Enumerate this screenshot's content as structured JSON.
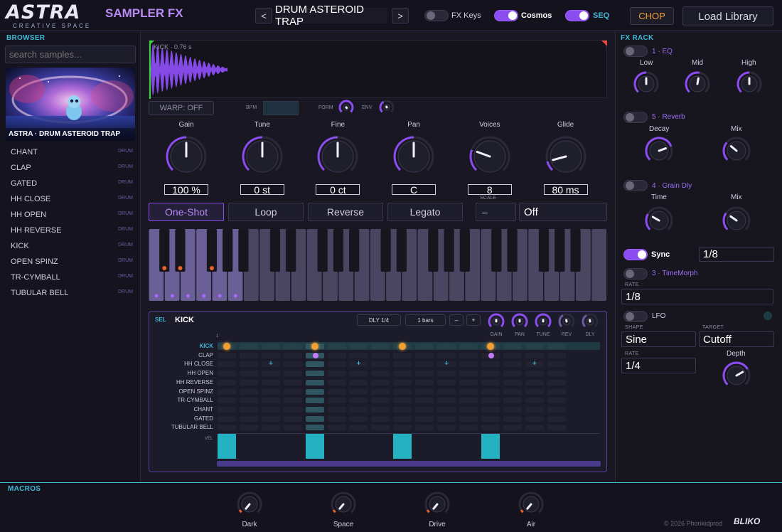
{
  "header": {
    "logo": "ASTRA",
    "logo_sub": "CREATIVE SPACE",
    "plugin_name": "SAMPLER FX",
    "prev": "<",
    "next": ">",
    "preset": "DRUM ASTEROID TRAP",
    "fx_keys": "FX Keys",
    "cosmos": "Cosmos",
    "seq": "SEQ",
    "chop": "CHOP",
    "load_library": "Load Library"
  },
  "browser": {
    "title": "BROWSER",
    "search_placeholder": "search samples...",
    "cover_caption": "ASTRA · DRUM ASTEROID TRAP",
    "items": [
      {
        "name": "CHANT",
        "tag": "DRUM"
      },
      {
        "name": "CLAP",
        "tag": "DRUM"
      },
      {
        "name": "GATED",
        "tag": "DRUM"
      },
      {
        "name": "HH CLOSE",
        "tag": "DRUM"
      },
      {
        "name": "HH OPEN",
        "tag": "DRUM"
      },
      {
        "name": "HH REVERSE",
        "tag": "DRUM"
      },
      {
        "name": "KICK",
        "tag": "DRUM"
      },
      {
        "name": "OPEN SPINZ",
        "tag": "DRUM"
      },
      {
        "name": "TR-CYMBALL",
        "tag": "DRUM"
      },
      {
        "name": "TUBULAR BELL",
        "tag": "DRUM"
      }
    ]
  },
  "sample": {
    "name": "KICK",
    "length": "0.76 s",
    "warp": "WARP: OFF",
    "bpm": "BPM",
    "form": "FORM",
    "env": "ENV"
  },
  "params": [
    {
      "label": "Gain",
      "value": "100 %",
      "angle": 0
    },
    {
      "label": "Tune",
      "value": "0 st",
      "angle": 0
    },
    {
      "label": "Fine",
      "value": "0 ct",
      "angle": 0
    },
    {
      "label": "Pan",
      "value": "C",
      "angle": 0
    },
    {
      "label": "Voices",
      "value": "8",
      "angle": -70
    },
    {
      "label": "Glide",
      "value": "80 ms",
      "angle": -105
    }
  ],
  "modes": {
    "one_shot": "One-Shot",
    "loop": "Loop",
    "reverse": "Reverse",
    "legato": "Legato",
    "scale_label": "SCALE",
    "scale_dash": "–",
    "scale_value": "Off"
  },
  "sequencer": {
    "sel": "SEL",
    "track": "KICK",
    "dly": "DLY 1/4",
    "bars": "1 bars",
    "minus": "–",
    "plus": "+",
    "step_one": "1",
    "knobs": [
      "GAIN",
      "PAN",
      "TUNE",
      "REV",
      "DLY"
    ],
    "rows": [
      "KICK",
      "CLAP",
      "HH CLOSE",
      "HH OPEN",
      "HH REVERSE",
      "OPEN SPINZ",
      "TR-CYMBALL",
      "CHANT",
      "GATED",
      "TUBULAR BELL"
    ],
    "vel": "VEL",
    "velocity": [
      1,
      0,
      0,
      0,
      1,
      0,
      0,
      0,
      1,
      0,
      0,
      0,
      1,
      0,
      0,
      0
    ]
  },
  "fx": {
    "title": "FX RACK",
    "eq": {
      "title": "1 · EQ",
      "low": "Low",
      "mid": "Mid",
      "high": "High"
    },
    "reverb": {
      "title": "5 · Reverb",
      "decay": "Decay",
      "mix": "Mix"
    },
    "grain": {
      "title": "4 · Grain Dly",
      "time": "Time",
      "mix": "Mix"
    },
    "sync": "Sync",
    "sync_value": "1/8",
    "timemorph": {
      "title": "3 · TimeMorph",
      "rate_label": "RATE",
      "rate": "1/8"
    },
    "lfo": {
      "title": "LFO",
      "shape_label": "SHAPE",
      "shape": "Sine",
      "target_label": "TARGET",
      "target": "Cutoff",
      "rate_label": "RATE",
      "rate": "1/4",
      "depth": "Depth"
    }
  },
  "macros": {
    "title": "MACROS",
    "items": [
      "Dark",
      "Space",
      "Drive",
      "Air"
    ]
  },
  "footer": {
    "copyright": "© 2026 Phonkidprod",
    "logo": "BLIKO"
  },
  "colors": {
    "accent": "#8b4df0",
    "cyan": "#3fb8d6",
    "orange": "#f2a033",
    "macro": "#e8622a"
  }
}
